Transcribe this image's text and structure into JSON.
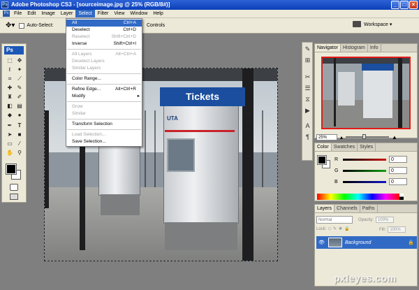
{
  "window": {
    "app_icon": "Ps",
    "title": "Adobe Photoshop CS3 - [sourceimage.jpg @ 25% (RGB/8#)]",
    "controls": [
      "_",
      "□",
      "×"
    ]
  },
  "menubar": {
    "app_chip": "Ps",
    "items": [
      "File",
      "Edit",
      "Image",
      "Layer",
      "Select",
      "Filter",
      "View",
      "Window",
      "Help"
    ],
    "active": "Select"
  },
  "options_bar": {
    "auto_select_label": "Auto-Select:",
    "controls_label": "Controls",
    "workspace_label": "Workspace ▾"
  },
  "toolbox": {
    "logo": "Ps"
  },
  "select_menu": {
    "items": [
      {
        "label": "All",
        "shortcut": "Ctrl+A",
        "state": "highlighted"
      },
      {
        "label": "Deselect",
        "shortcut": "Ctrl+D",
        "state": "enabled"
      },
      {
        "label": "Reselect",
        "shortcut": "Shift+Ctrl+D",
        "state": "disabled"
      },
      {
        "label": "Inverse",
        "shortcut": "Shift+Ctrl+I",
        "state": "enabled"
      },
      {
        "separator": true
      },
      {
        "label": "All Layers",
        "shortcut": "Alt+Ctrl+A",
        "state": "disabled"
      },
      {
        "label": "Deselect Layers",
        "shortcut": "",
        "state": "disabled"
      },
      {
        "label": "Similar Layers",
        "shortcut": "",
        "state": "disabled"
      },
      {
        "separator": true
      },
      {
        "label": "Color Range...",
        "shortcut": "",
        "state": "enabled"
      },
      {
        "separator": true
      },
      {
        "label": "Refine Edge...",
        "shortcut": "Alt+Ctrl+R",
        "state": "enabled"
      },
      {
        "label": "Modify",
        "shortcut": "",
        "state": "submenu"
      },
      {
        "separator": true
      },
      {
        "label": "Grow",
        "shortcut": "",
        "state": "disabled"
      },
      {
        "label": "Similar",
        "shortcut": "",
        "state": "disabled"
      },
      {
        "separator": true
      },
      {
        "label": "Transform Selection",
        "shortcut": "",
        "state": "enabled"
      },
      {
        "separator": true
      },
      {
        "label": "Load Selection...",
        "shortcut": "",
        "state": "disabled"
      },
      {
        "label": "Save Selection...",
        "shortcut": "",
        "state": "enabled"
      }
    ]
  },
  "canvas": {
    "sign_text": "Tickets",
    "brand_text": "UTA"
  },
  "navigator_panel": {
    "tabs": [
      "Navigator",
      "Histogram",
      "Info"
    ],
    "zoom": "25%"
  },
  "color_panel": {
    "tabs": [
      "Color",
      "Swatches",
      "Styles"
    ],
    "channels": [
      {
        "label": "R",
        "value": "0",
        "color": "#d21414"
      },
      {
        "label": "G",
        "value": "0",
        "color": "#14a014"
      },
      {
        "label": "B",
        "value": "0",
        "color": "#1414c8"
      }
    ]
  },
  "layers_panel": {
    "tabs": [
      "Layers",
      "Channels",
      "Paths"
    ],
    "blend_mode": "Normal",
    "opacity_label": "Opacity:",
    "opacity_value": "100%",
    "lock_label": "Lock:",
    "fill_label": "Fill:",
    "fill_value": "100%",
    "layer_name": "Background"
  },
  "watermark": "pxleyes.com",
  "colors": {
    "title_bar": "#1d4fc4",
    "menu_highlight": "#316ac5",
    "chrome": "#ece9d8",
    "workspace_bg": "#7f7f7f",
    "kiosk_blue": "#1b4e9e",
    "navigator_frame": "#e21a1a"
  }
}
